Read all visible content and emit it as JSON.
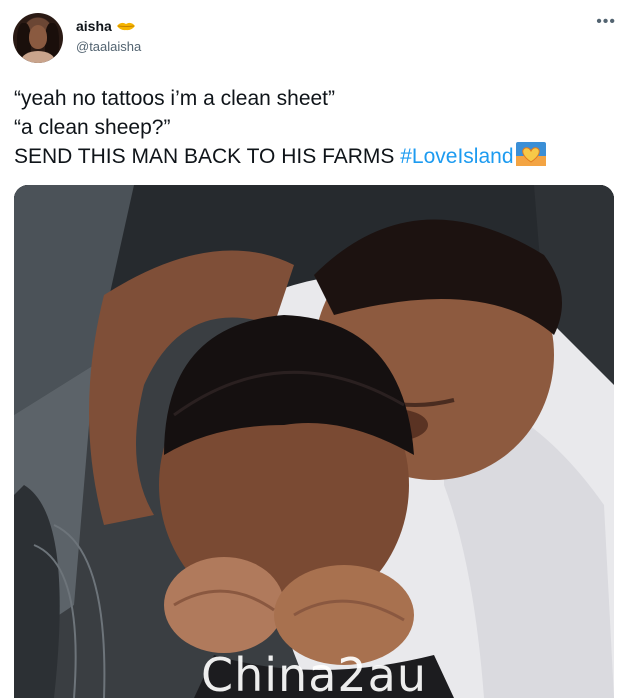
{
  "user": {
    "display_name": "aisha",
    "handle": "@taalaisha",
    "name_emoji": "lips-emoji",
    "avatar": "profile-photo"
  },
  "menu_icon": "more-options-icon",
  "tweet": {
    "line1": "“yeah no tattoos i’m a clean sheet”",
    "line2": "“a clean sheep?”",
    "line3": "SEND THIS MAN BACK TO HIS FARMS ",
    "hashtag": "#LoveIsland",
    "hashtag_emoji": "love-island-heart-emoji"
  },
  "media": {
    "type": "video-still",
    "watermark": "Chinа2au"
  },
  "colors": {
    "hashtag": "#1d9bf0",
    "handle": "#536471",
    "text": "#0f1419"
  }
}
